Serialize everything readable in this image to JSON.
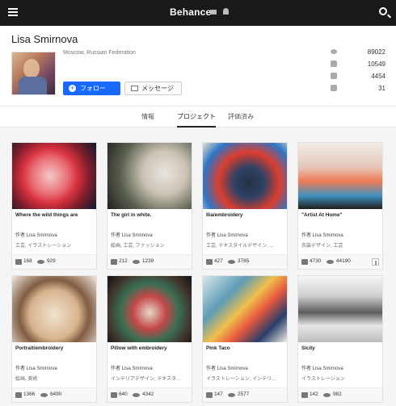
{
  "topbar": {
    "brand": "Behance"
  },
  "profile": {
    "name": "Lisa Smirnova",
    "location": "Moscow, Russian Federation",
    "follow_label": "フォロー",
    "message_label": "メッセージ",
    "stats": [
      "89022",
      "10549",
      "4454",
      "31"
    ]
  },
  "tabs": [
    {
      "label": "情報"
    },
    {
      "label": "プロジェクト"
    },
    {
      "label": "評価済み"
    }
  ],
  "cards": [
    {
      "title": "Where the wild things are",
      "author": "作者 Lisa Smirnova",
      "category": "工芸, イラストレーション",
      "likes": "168",
      "views": "929"
    },
    {
      "title": "The girl in white.",
      "author": "作者 Lisa Smirnova",
      "category": "絵画, 工芸, ファッション",
      "likes": "212",
      "views": "1239"
    },
    {
      "title": "Ilia/embroidery",
      "author": "作者 Lisa Smirnova",
      "category": "工芸, テキスタイルデザイン, ...",
      "likes": "427",
      "views": "3785"
    },
    {
      "title": "\"Artist At Home\"",
      "author": "作者 Lisa Smirnova",
      "category": "衣装デザイン, 工芸",
      "likes": "4730",
      "views": "44190"
    },
    {
      "title": "Portrait/embroidery",
      "author": "作者 Lisa Smirnova",
      "category": "絵画, 美術",
      "likes": "1366",
      "views": "6490"
    },
    {
      "title": "Pillow with embroidery",
      "author": "作者 Lisa Smirnova",
      "category": "インテリアデザイン, テキスタ...",
      "likes": "640",
      "views": "4342"
    },
    {
      "title": "Pink Taco",
      "author": "作者 Lisa Smirnova",
      "category": "イラストレーション, インテリ...",
      "likes": "147",
      "views": "2577"
    },
    {
      "title": "Sicily",
      "author": "作者 Lisa Smirnova",
      "category": "イラストレーション",
      "likes": "142",
      "views": "982"
    }
  ]
}
